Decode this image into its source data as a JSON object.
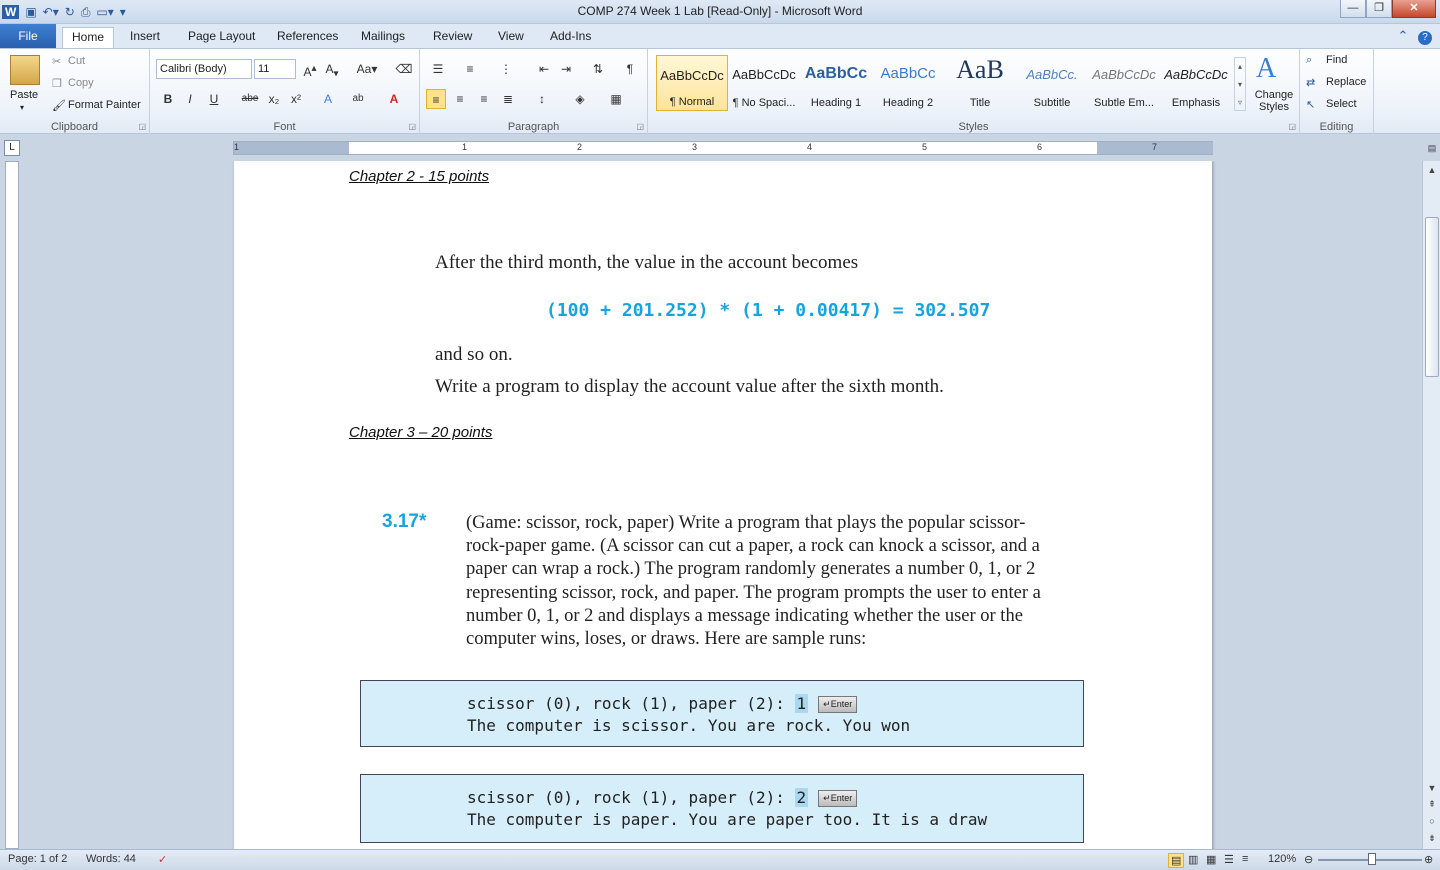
{
  "window": {
    "title": "COMP 274 Week 1 Lab [Read-Only]  -  Microsoft Word",
    "minimize": "—",
    "restore": "❐",
    "close": "✕"
  },
  "tabs": [
    "File",
    "Home",
    "Insert",
    "Page Layout",
    "References",
    "Mailings",
    "Review",
    "View",
    "Add-Ins"
  ],
  "ribbon": {
    "clipboard": {
      "label": "Clipboard",
      "paste": "Paste",
      "cut": "Cut",
      "copy": "Copy",
      "format_painter": "Format Painter"
    },
    "font": {
      "label": "Font",
      "font_name": "Calibri (Body)",
      "font_size": "11"
    },
    "paragraph": {
      "label": "Paragraph"
    },
    "styles": {
      "label": "Styles",
      "items": [
        {
          "preview": "AaBbCcDc",
          "name": "¶ Normal"
        },
        {
          "preview": "AaBbCcDc",
          "name": "¶ No Spaci..."
        },
        {
          "preview": "AaBbCc",
          "name": "Heading 1"
        },
        {
          "preview": "AaBbCc",
          "name": "Heading 2"
        },
        {
          "preview": "AaB",
          "name": "Title"
        },
        {
          "preview": "AaBbCc.",
          "name": "Subtitle"
        },
        {
          "preview": "AaBbCcDc",
          "name": "Subtle Em..."
        },
        {
          "preview": "AaBbCcDc",
          "name": "Emphasis"
        }
      ],
      "change_styles": "Change Styles"
    },
    "editing": {
      "label": "Editing",
      "find": "Find",
      "replace": "Replace",
      "select": "Select"
    }
  },
  "ruler_numbers": [
    "1",
    "1",
    "2",
    "3",
    "4",
    "5",
    "6",
    "7"
  ],
  "document": {
    "heading_ch2": "Chapter 2 - 15 points",
    "line1": "After the third month, the value in the account becomes",
    "equation": "(100 + 201.252) * (1 + 0.00417) = 302.507",
    "line2": "and so on.",
    "line3": "Write a program to display the account value after the sixth month.",
    "heading_ch3": "Chapter 3 – 20 points",
    "exercise_number": "3.17*",
    "exercise_lines": [
      "(Game: scissor, rock, paper) Write a program that plays the popular scissor-",
      "rock-paper game. (A scissor can cut a paper, a rock can knock a scissor, and a",
      "paper can wrap a rock.) The program randomly generates a number 0, 1, or 2",
      "representing scissor, rock, and paper. The program prompts the user to enter a",
      "number 0, 1, or 2 and displays a message indicating whether the user or the",
      "computer wins, loses, or draws. Here are sample runs:"
    ],
    "samples": [
      {
        "prompt": "scissor (0), rock (1), paper (2): ",
        "input": "1",
        "enter": "↵Enter",
        "output": "The computer is scissor. You are rock. You won"
      },
      {
        "prompt": "scissor (0), rock (1), paper (2): ",
        "input": "2",
        "enter": "↵Enter",
        "output": "The computer is paper. You are paper too. It is a draw"
      }
    ]
  },
  "status": {
    "page": "Page: 1 of 2",
    "words": "Words: 44",
    "zoom": "120%"
  }
}
